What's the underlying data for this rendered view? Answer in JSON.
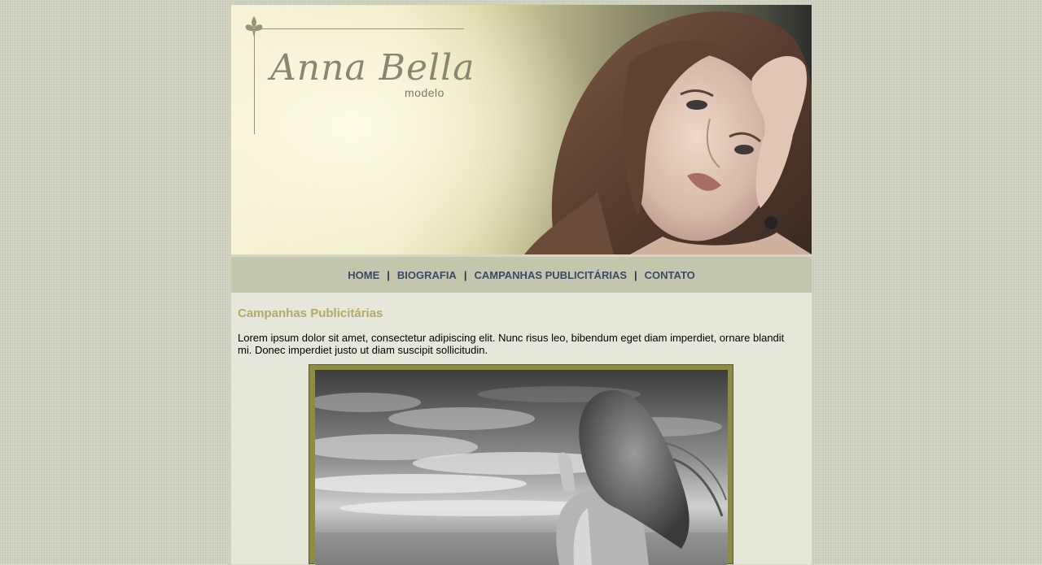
{
  "banner": {
    "logo_name": "Anna Bella",
    "logo_sub": "modelo"
  },
  "nav": {
    "items": [
      {
        "label": "HOME"
      },
      {
        "label": "BIOGRAFIA"
      },
      {
        "label": "CAMPANHAS PUBLICITÁRIAS"
      },
      {
        "label": "CONTATO"
      }
    ],
    "separator": "|"
  },
  "main": {
    "heading": "Campanhas Publicitárias",
    "paragraph": "Lorem ipsum dolor sit amet, consectetur adipiscing elit. Nunc risus leo, bibendum eget diam imperdiet, ornare blandit mi. Donec imperdiet justo ut diam suscipit sollicitudin."
  },
  "colors": {
    "page_bg": "#cfd0bf",
    "content_bg": "#e6e7da",
    "nav_bg": "#c3c5ad",
    "nav_text": "#3d4a66",
    "heading": "#b3a96a",
    "photo_frame": "#8e8a48"
  }
}
